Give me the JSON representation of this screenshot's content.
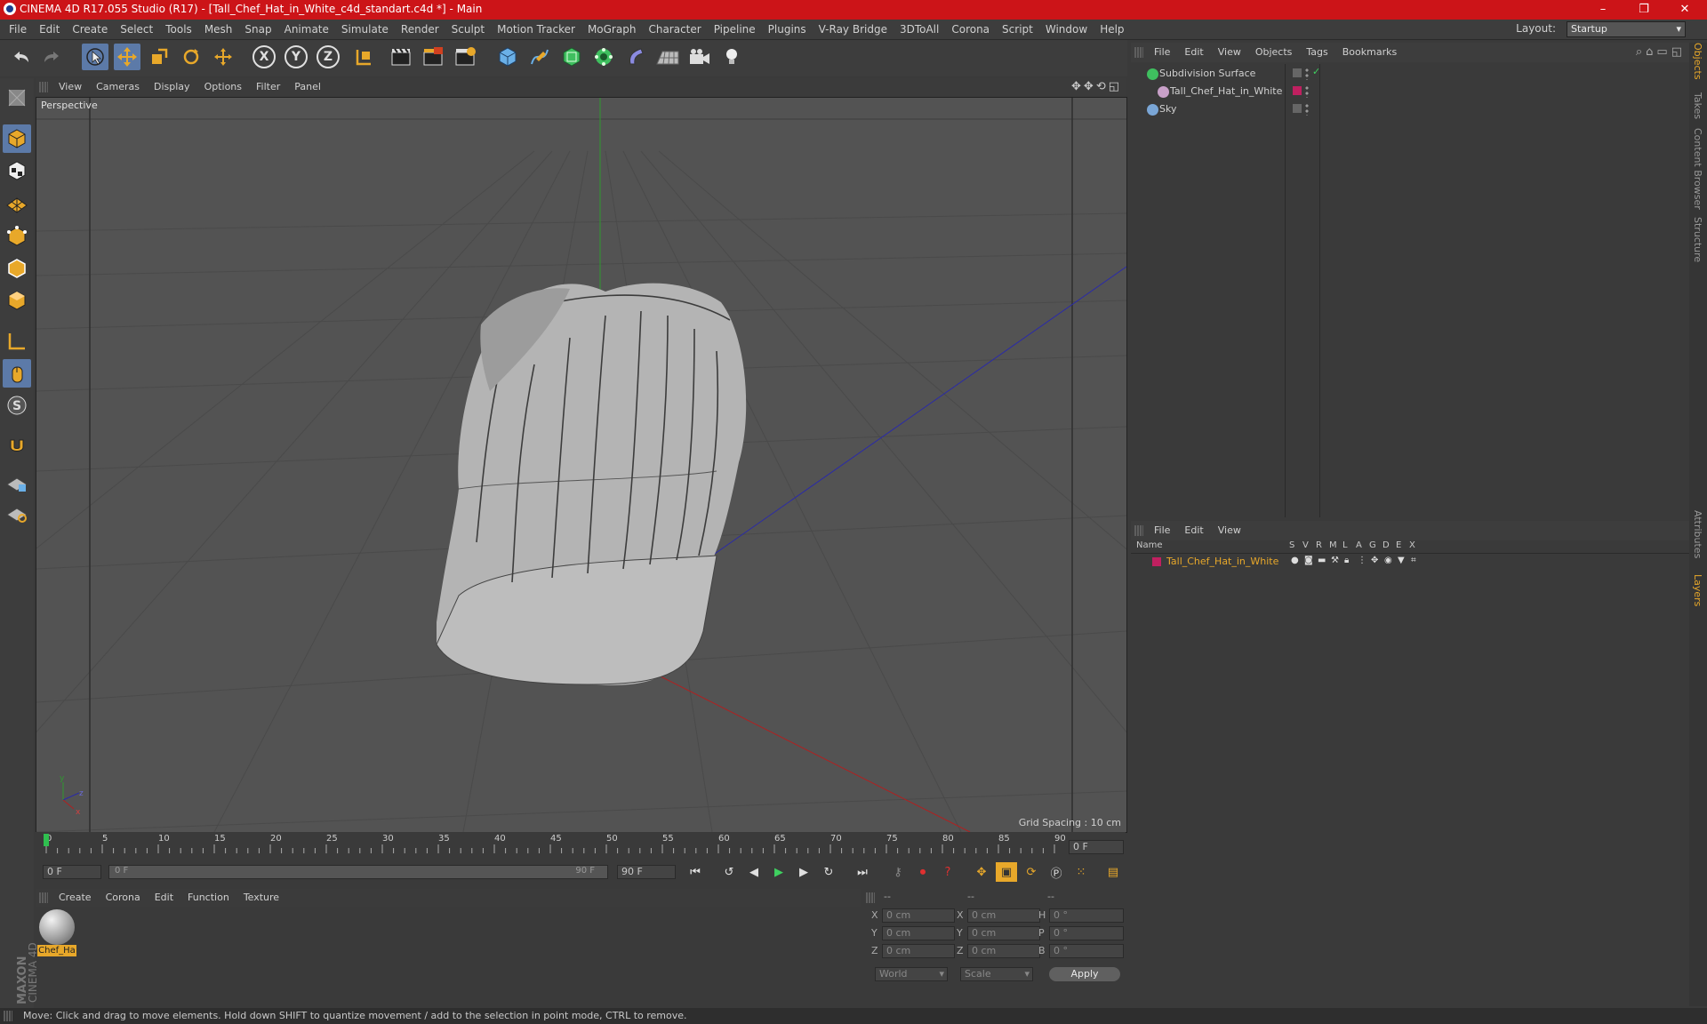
{
  "window": {
    "title": "CINEMA 4D R17.055 Studio (R17) - [Tall_Chef_Hat_in_White_c4d_standart.c4d *] - Main",
    "minimize": "–",
    "restore": "❐",
    "close": "✕"
  },
  "menubar": {
    "items": [
      "File",
      "Edit",
      "Create",
      "Select",
      "Tools",
      "Mesh",
      "Snap",
      "Animate",
      "Simulate",
      "Render",
      "Sculpt",
      "Motion Tracker",
      "MoGraph",
      "Character",
      "Pipeline",
      "Plugins",
      "V-Ray Bridge",
      "3DToAll",
      "Corona",
      "Script",
      "Window",
      "Help"
    ],
    "layout_label": "Layout:",
    "layout_value": "Startup"
  },
  "toolbar": {
    "axis_x": "X",
    "axis_y": "Y",
    "axis_z": "Z"
  },
  "viewport": {
    "menu": [
      "View",
      "Cameras",
      "Display",
      "Options",
      "Filter",
      "Panel"
    ],
    "camera_label": "Perspective",
    "grid_spacing": "Grid Spacing : 10 cm"
  },
  "timeline": {
    "ticks": [
      "0",
      "5",
      "10",
      "15",
      "20",
      "25",
      "30",
      "35",
      "40",
      "45",
      "50",
      "55",
      "60",
      "65",
      "70",
      "75",
      "80",
      "85",
      "90"
    ],
    "current_frame": "0 F",
    "start_frame": "0 F",
    "range_start": "0 F",
    "range_end": "90 F",
    "end_frame": "90 F"
  },
  "material_manager": {
    "menu": [
      "Create",
      "Corona",
      "Edit",
      "Function",
      "Texture"
    ],
    "materials": [
      {
        "name": "Chef_Ha"
      }
    ],
    "brand_line1": "MAXON",
    "brand_line2": "CINEMA 4D"
  },
  "coordinates": {
    "headers": [
      "--",
      "--",
      "--"
    ],
    "rows": [
      {
        "a": "X",
        "av": "0 cm",
        "b": "X",
        "bv": "0 cm",
        "c": "H",
        "cv": "0 °"
      },
      {
        "a": "Y",
        "av": "0 cm",
        "b": "Y",
        "bv": "0 cm",
        "c": "P",
        "cv": "0 °"
      },
      {
        "a": "Z",
        "av": "0 cm",
        "b": "Z",
        "bv": "0 cm",
        "c": "B",
        "cv": "0 °"
      }
    ],
    "mode": "World",
    "scale": "Scale",
    "apply": "Apply"
  },
  "status": "Move: Click and drag to move elements. Hold down SHIFT to quantize movement / add to the selection in point mode, CTRL to remove.",
  "object_manager": {
    "menu": [
      "File",
      "Edit",
      "View",
      "Objects",
      "Tags",
      "Bookmarks"
    ],
    "objects": [
      {
        "name": "Subdivision Surface",
        "color": "#3fbf5f"
      },
      {
        "name": "Tall_Chef_Hat_in_White",
        "color": "#c8a0c8"
      },
      {
        "name": "Sky",
        "color": "#7aa6d6"
      }
    ]
  },
  "layer_manager": {
    "menu": [
      "File",
      "Edit",
      "View"
    ],
    "columns": [
      "Name",
      "S",
      "V",
      "R",
      "M",
      "L",
      "A",
      "G",
      "D",
      "E",
      "X"
    ],
    "layers": [
      {
        "name": "Tall_Chef_Hat_in_White",
        "color": "#e8a82a"
      }
    ]
  },
  "right_tabs": [
    "Objects",
    "Takes",
    "Content Browser",
    "Structure",
    "Attributes",
    "Layers"
  ]
}
